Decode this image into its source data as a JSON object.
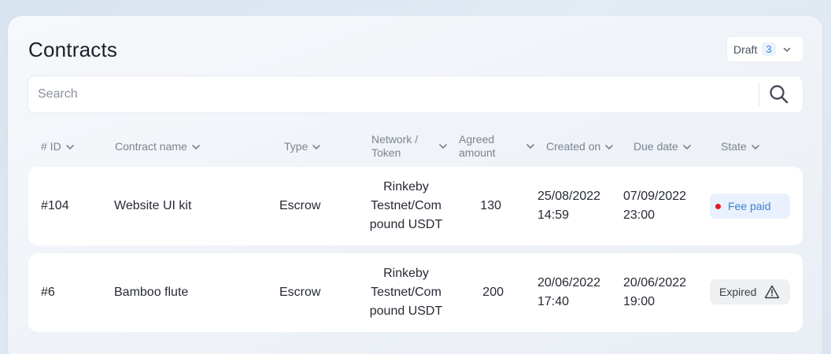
{
  "page": {
    "title": "Contracts",
    "draft": {
      "label": "Draft",
      "count": "3"
    },
    "search": {
      "placeholder": "Search",
      "value": ""
    }
  },
  "columns": [
    {
      "label": "# ID"
    },
    {
      "label": "Contract name"
    },
    {
      "label": "Type"
    },
    {
      "label_line1": "Network /",
      "label_line2": "Token"
    },
    {
      "label_line1": "Agreed",
      "label_line2": "amount"
    },
    {
      "label": "Created on"
    },
    {
      "label": "Due date"
    },
    {
      "label": "State"
    }
  ],
  "rows": [
    {
      "id": "#104",
      "name": "Website UI kit",
      "type": "Escrow",
      "network": [
        "Rinkeby",
        "Testnet/Com",
        "pound USDT"
      ],
      "amount": "130",
      "created": [
        "25/08/2022",
        "14:59"
      ],
      "due": [
        "07/09/2022",
        "23:00"
      ],
      "state": "Fee paid",
      "state_color": "#3d7fd6",
      "state_dot_color": "#e31b23",
      "state_icon": "dot-icon"
    },
    {
      "id": "#6",
      "name": "Bamboo flute",
      "type": "Escrow",
      "network": [
        "Rinkeby",
        "Testnet/Com",
        "pound USDT"
      ],
      "amount": "200",
      "created": [
        "20/06/2022",
        "17:40"
      ],
      "due": [
        "20/06/2022",
        "19:00"
      ],
      "state": "Expired",
      "state_color": "#3a3f4a",
      "state_icon": "warning-icon"
    }
  ],
  "icons": {
    "search": "search-icon",
    "chevron": "chevron-down-icon",
    "warning": "warning-icon"
  }
}
